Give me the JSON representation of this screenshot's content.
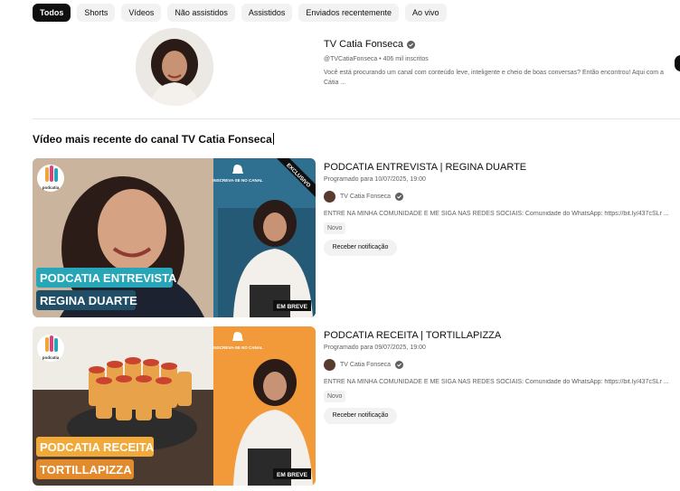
{
  "chips": [
    "Todos",
    "Shorts",
    "Vídeos",
    "Não assistidos",
    "Assistidos",
    "Enviados recentemente",
    "Ao vivo"
  ],
  "channel": {
    "name": "TV Catia Fonseca",
    "handle_subs": "@TVCatiaFonseca • 406 mil inscritos",
    "description": "Você está procurando um canal com conteúdo leve, inteligente e cheio de boas conversas? Então encontrou! Aqui com a Cátia ..."
  },
  "section_title": "Vídeo mais recente do canal TV Catia Fonseca",
  "videos": [
    {
      "title": "PODCATIA ENTREVISTA | REGINA DUARTE",
      "scheduled": "Programado para 10/07/2025, 19:00",
      "channel": "TV Catia Fonseca",
      "description": "ENTRE NA MINHA COMUNIDADE E ME SIGA NAS REDES SOCIAIS: Comunidade do WhatsApp: https://bit.ly/437cSLr ...",
      "badge": "Novo",
      "notify": "Receber notificação",
      "thumb": {
        "line1": "PODCATIA ENTREVISTA",
        "line2": "REGINA DUARTE",
        "logo": "podcatia",
        "subscribe": "INSCREVA-SE NO CANAL",
        "exclusive": "EXCLUSIVO",
        "soon": "EM BREVE",
        "panel_color": "#2f6f8f",
        "bg_color": "#c9b8a6",
        "label_color": "#26a6b6"
      }
    },
    {
      "title": "PODCATIA RECEITA | TORTILLAPIZZA",
      "scheduled": "Programado para 09/07/2025, 19:00",
      "channel": "TV Catia Fonseca",
      "description": "ENTRE NA MINHA COMUNIDADE E ME SIGA NAS REDES SOCIAIS: Comunidade do WhatsApp: https://bit.ly/437cSLr ...",
      "badge": "Novo",
      "notify": "Receber notificação",
      "thumb": {
        "line1": "PODCATIA RECEITA",
        "line2": "TORTILLAPIZZA",
        "logo": "podcatia",
        "subscribe": "INSCREVA-SE NO CANAL",
        "soon": "EM BREVE",
        "panel_color": "#f29a3a",
        "bg_color": "#6b4f3a",
        "label_color": "#f1a93a"
      }
    }
  ],
  "icons": [
    "verified-icon",
    "podcatia-logo-icon",
    "bell-icon"
  ]
}
